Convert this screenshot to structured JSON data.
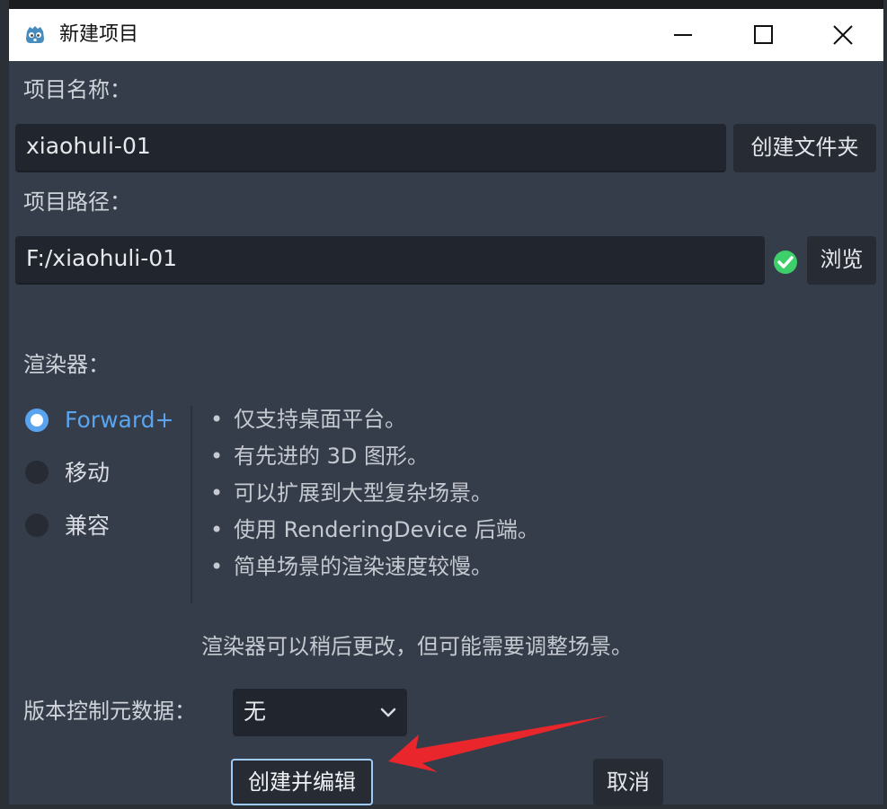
{
  "window": {
    "title": "新建项目"
  },
  "project_name": {
    "label": "项目名称：",
    "value": "xiaohuli-01",
    "create_folder_label": "创建文件夹"
  },
  "project_path": {
    "label": "项目路径：",
    "value": "F:/xiaohuli-01",
    "status_icon": "check-circle-icon",
    "status_color": "#3ecf6b",
    "browse_label": "浏览"
  },
  "renderer": {
    "label": "渲染器：",
    "options": [
      {
        "label": "Forward+",
        "selected": true
      },
      {
        "label": "移动",
        "selected": false
      },
      {
        "label": "兼容",
        "selected": false
      }
    ],
    "bullets": [
      "仅支持桌面平台。",
      "有先进的 3D 图形。",
      "可以扩展到大型复杂场景。",
      "使用 RenderingDevice 后端。",
      "简单场景的渲染速度较慢。"
    ],
    "bullet_char": "•",
    "note": "渲染器可以稍后更改，但可能需要调整场景。"
  },
  "vcs": {
    "label": "版本控制元数据：",
    "selected": "无"
  },
  "footer": {
    "create_label": "创建并编辑",
    "cancel_label": "取消"
  },
  "colors": {
    "accent": "#5aa4ef",
    "annotation_arrow": "#e8262b",
    "dialog_bg": "#363d4a"
  }
}
